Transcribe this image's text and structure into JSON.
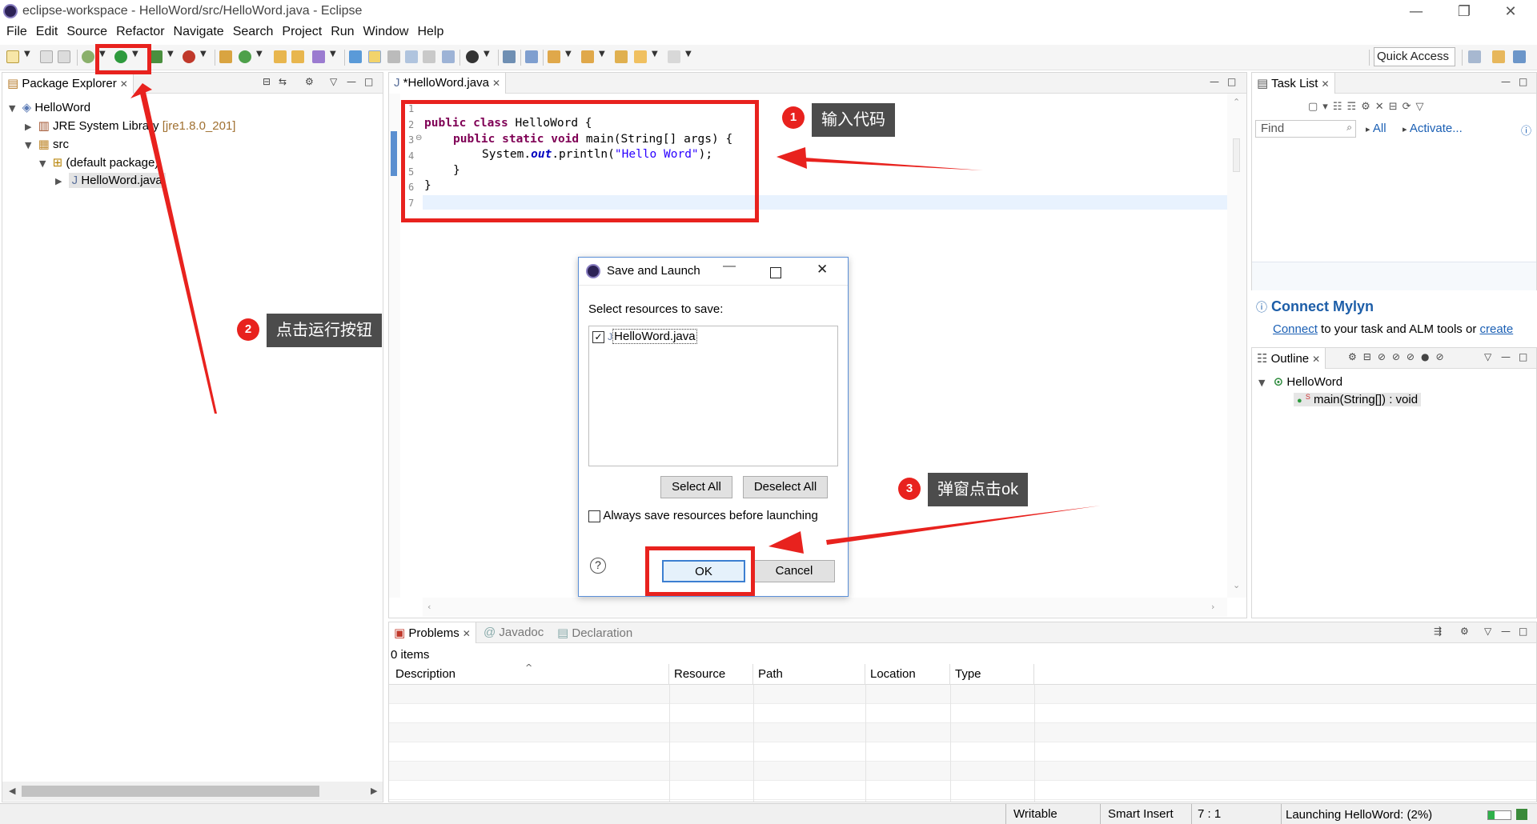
{
  "window": {
    "title": "eclipse-workspace - HelloWord/src/HelloWord.java - Eclipse",
    "minimize": "—",
    "restore": "❐",
    "close": "✕"
  },
  "menu": [
    "File",
    "Edit",
    "Source",
    "Refactor",
    "Navigate",
    "Search",
    "Project",
    "Run",
    "Window",
    "Help"
  ],
  "toolbar": {
    "quick_access": "Quick Access"
  },
  "package_explorer": {
    "tab_label": "Package Explorer",
    "tree": [
      {
        "label": "HelloWord",
        "icon": "project-icon"
      },
      {
        "label": "JRE System Library",
        "suffix": "[jre1.8.0_201]",
        "icon": "library-icon"
      },
      {
        "label": "src",
        "icon": "source-folder-icon"
      },
      {
        "label": "(default package)",
        "icon": "package-icon"
      },
      {
        "label": "HelloWord.java",
        "icon": "java-file-icon"
      }
    ]
  },
  "editor": {
    "tab_label": "*HelloWord.java",
    "line_numbers": [
      "1",
      "2",
      "3",
      "4",
      "5",
      "6",
      "7"
    ],
    "code": {
      "l2_kw": "public class",
      "l2_rest": " HelloWord {",
      "l3_kw": "public static void",
      "l3_rest": " main(String[] args) {",
      "l4_pre": "System.",
      "l4_field": "out",
      "l4_mid": ".println(",
      "l4_str": "\"Hello Word\"",
      "l4_end": ");",
      "l5": "}",
      "l6": "}"
    }
  },
  "task_list": {
    "tab_label": "Task List",
    "find_placeholder": "Find",
    "all_label": "All",
    "activate_label": "Activate...",
    "mylyn_title": "Connect Mylyn",
    "mylyn_link": "Connect",
    "mylyn_text": " to your task and ALM tools or ",
    "mylyn_create": "create"
  },
  "outline": {
    "tab_label": "Outline",
    "class_name": "HelloWord",
    "method": "main(String[]) : void"
  },
  "dialog": {
    "title": "Save and Launch",
    "prompt": "Select resources to save:",
    "resource": "HelloWord.java",
    "select_all": "Select All",
    "deselect_all": "Deselect All",
    "always_save": "Always save resources before launching",
    "help": "?",
    "ok": "OK",
    "cancel": "Cancel"
  },
  "problems": {
    "tabs": [
      "Problems",
      "Javadoc",
      "Declaration"
    ],
    "count": "0 items",
    "columns": [
      "Description",
      "Resource",
      "Path",
      "Location",
      "Type"
    ]
  },
  "status": {
    "writable": "Writable",
    "insert_mode": "Smart Insert",
    "position": "7 : 1",
    "launching": "Launching HelloWord: (2%)"
  },
  "annotations": [
    {
      "num": "1",
      "text": "输入代码"
    },
    {
      "num": "2",
      "text": "点击运行按钮"
    },
    {
      "num": "3",
      "text": "弹窗点击ok"
    }
  ],
  "colors": {
    "annotation_red": "#e8221e",
    "callout_bg": "#4c4c4c",
    "keyword": "#7f0055",
    "string": "#2a00ff",
    "link": "#1a5fb4"
  }
}
